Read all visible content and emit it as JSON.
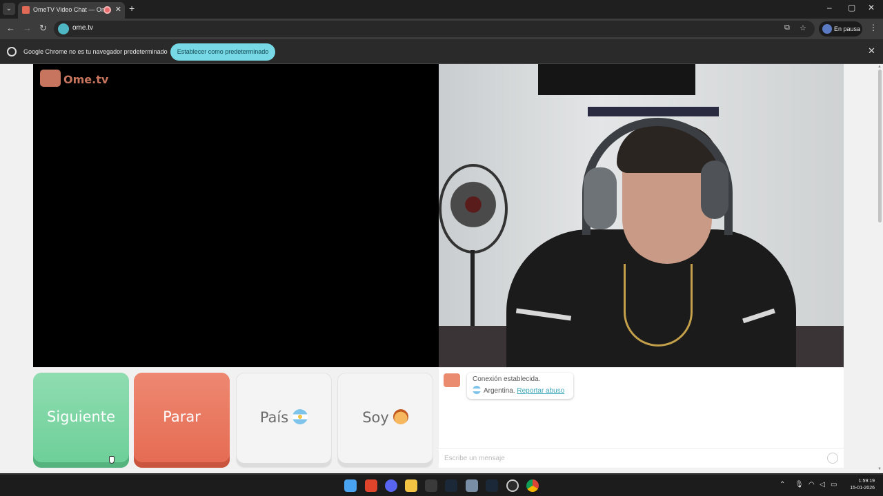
{
  "browser": {
    "tab_menu_glyph": "⌄",
    "tab_title": "OmeTV Video Chat — Ome",
    "tab_close_glyph": "✕",
    "new_tab_glyph": "+",
    "window_controls": {
      "minimize": "–",
      "maximize": "▢",
      "close": "✕"
    },
    "nav": {
      "back": "←",
      "forward": "→",
      "reload": "↻"
    },
    "url": "ome.tv",
    "url_actions": {
      "install": "⧉",
      "bookmark": "☆"
    },
    "profile_label": "En pausa",
    "menu_glyph": "⋮"
  },
  "infobar": {
    "message": "Google Chrome no es tu navegador predeterminado",
    "action_label": "Establecer como predeterminado",
    "close_glyph": "✕"
  },
  "page": {
    "logo_text": "Ome.tv",
    "buttons": {
      "next": "Siguiente",
      "stop": "Parar",
      "country": "País",
      "gender": "Soy"
    },
    "chat": {
      "status_line": "Conexión establecida.",
      "country": "Argentina.",
      "report_link": "Reportar abuso",
      "input_placeholder": "Escribe un mensaje"
    }
  },
  "taskbar": {
    "tray_chevron": "⌃",
    "time": "1:59:19",
    "date": "15-01-2026"
  },
  "colors": {
    "next_button": "#6ccf98",
    "stop_button": "#e56a52",
    "accent": "#3aa6b8",
    "infobar_button": "#78d9e6"
  },
  "icons": [
    "chrome-icon",
    "windows-start-icon",
    "brave-icon",
    "discord-icon",
    "file-explorer-icon",
    "epic-games-icon",
    "steam-icon",
    "settings-icon",
    "steam-alt-icon",
    "obs-icon",
    "chrome-taskbar-icon",
    "microphone-icon",
    "wifi-icon",
    "volume-icon",
    "battery-icon"
  ]
}
